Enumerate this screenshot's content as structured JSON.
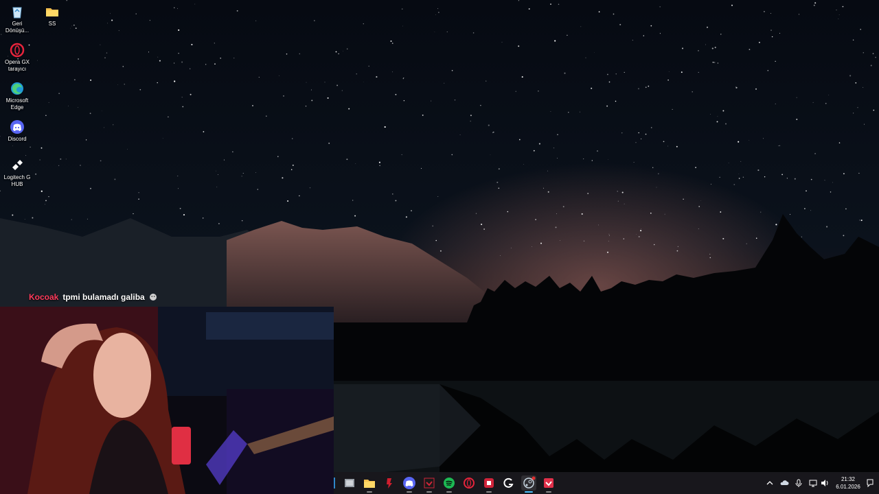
{
  "desktop": {
    "icons": [
      {
        "label": "Geri Dönüşü...",
        "icon": "recycle-bin-icon"
      },
      {
        "label": "SS",
        "icon": "folder-icon"
      },
      {
        "label": "Opera GX tarayıcı",
        "icon": "opera-gx-icon"
      },
      {
        "label": "Microsoft Edge",
        "icon": "edge-icon"
      },
      {
        "label": "Discord",
        "icon": "discord-icon"
      },
      {
        "label": "Logitech G HUB",
        "icon": "logitech-ghub-icon"
      }
    ]
  },
  "chat": {
    "user": "Kocoak",
    "message": "tpmi bulamadı galiba",
    "emote": "emote-icon"
  },
  "taskbar": {
    "apps": [
      "task-view-icon",
      "file-explorer-icon",
      "red-app-icon",
      "discord-icon",
      "red-checkmark-app-icon",
      "spotify-icon",
      "opera-icon",
      "red-box-app-icon",
      "logitech-g-icon",
      "steam-icon",
      "red-checkmark-app-icon"
    ],
    "tray": [
      "chevron-up-icon",
      "cloud-icon",
      "microphone-icon",
      "network-icon",
      "volume-icon"
    ],
    "time": "21:32",
    "date": "6.01.2026"
  },
  "colors": {
    "chat_user": "#ff3b5c",
    "taskbar": "#18181c",
    "spotify": "#1db954",
    "discord": "#5865f2"
  }
}
